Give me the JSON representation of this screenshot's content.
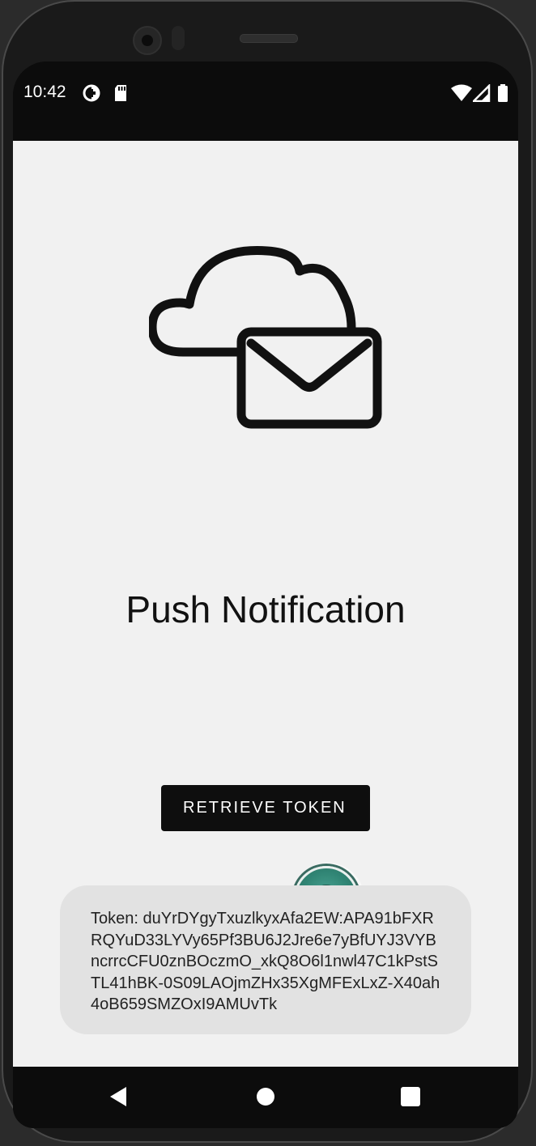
{
  "status_bar": {
    "time": "10:42",
    "left_icons": [
      "data-saver-icon",
      "sd-card-icon"
    ],
    "right_icons": [
      "wifi-icon",
      "cell-signal-icon",
      "battery-icon"
    ]
  },
  "app": {
    "hero_icon": "cloud-mail-icon",
    "title": "Push Notification",
    "retrieve_button_label": "RETRIEVE TOKEN",
    "token_text": "Token: duYrDYgyTxuzlkyxAfa2EW:APA91bFXRRQYuD33LYVy65Pf3BU6J2Jre6e7yBfUYJ3VYBncrrcCFU0znBOczmO_xkQ8O6l1nwl47C1kPstSTL41hBK-0S09LAOjmZHx35XgMFExLxZ-X40ah4oB659SMZOxI9AMUvTk"
  },
  "nav_bar": {
    "buttons": [
      "back-icon",
      "home-icon",
      "recents-icon"
    ]
  },
  "colors": {
    "app_background": "#f1f1f1",
    "button_background": "#0e0e0e",
    "token_box_background": "#e2e2e2",
    "system_bar": "#0c0c0c",
    "touch_indicator": "#1f7a68"
  }
}
